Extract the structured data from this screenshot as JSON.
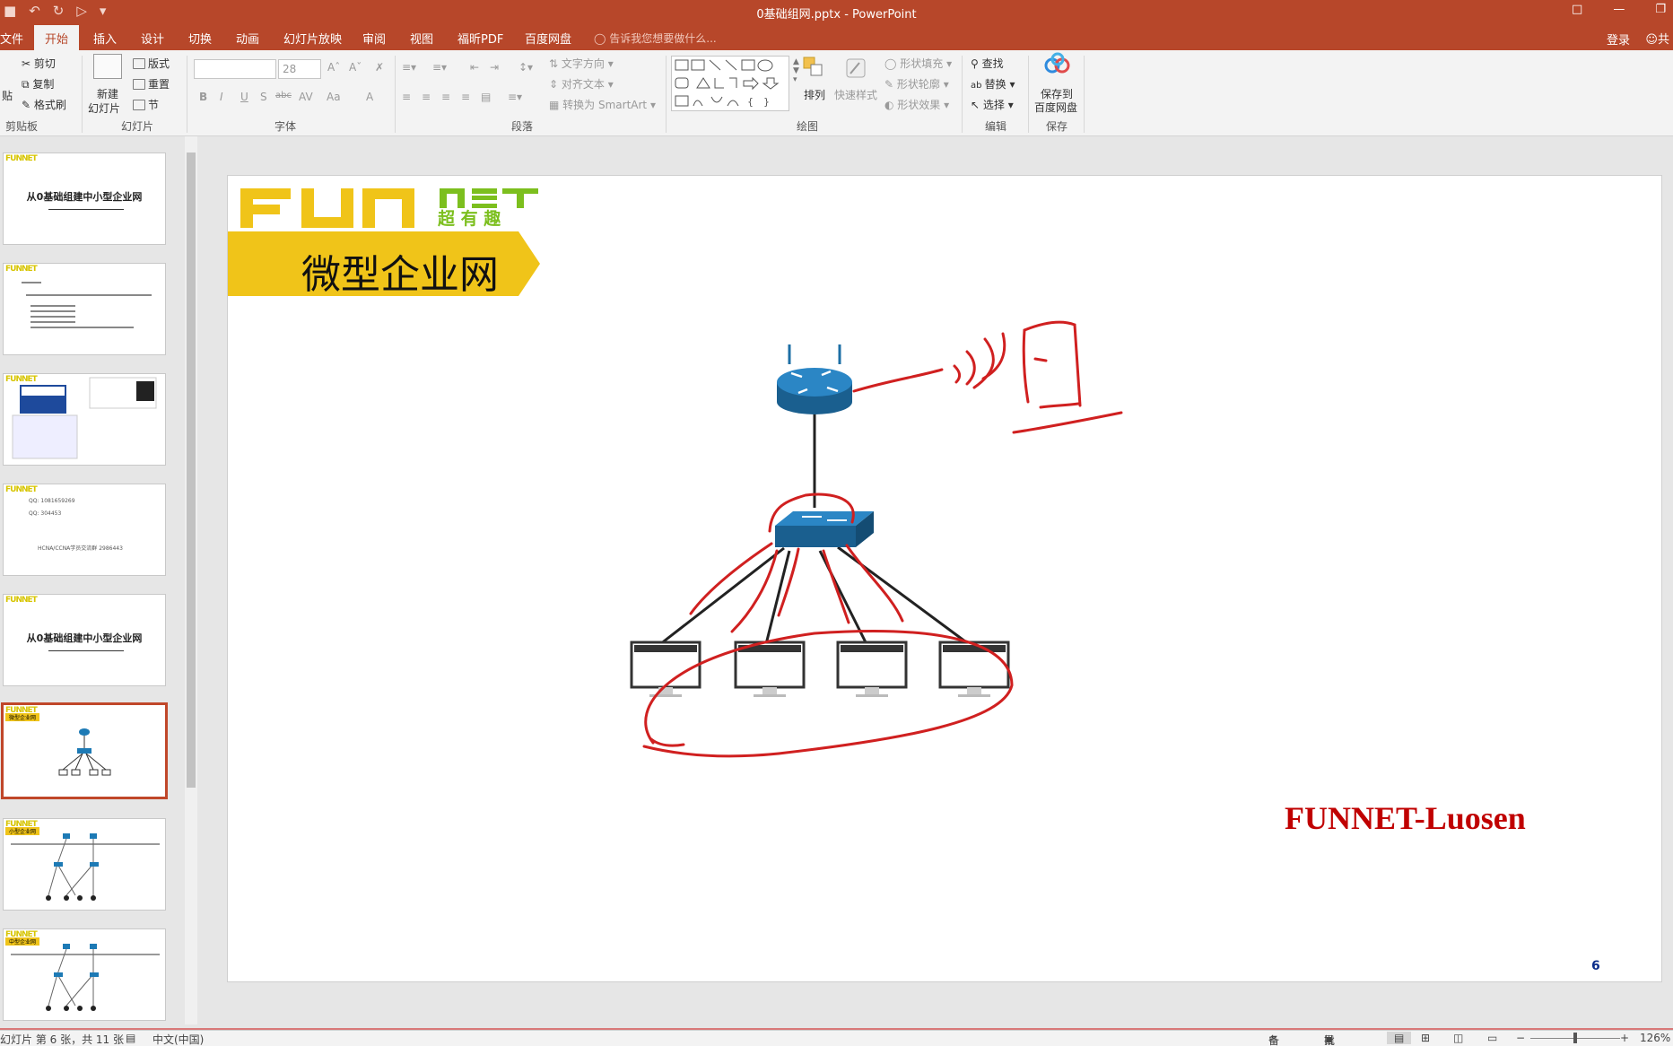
{
  "window": {
    "title": "0基础组网.pptx - PowerPoint"
  },
  "titlebar_icons": [
    "save-icon",
    "undo-icon",
    "redo-icon",
    "present-icon",
    "qat-dropdown-icon"
  ],
  "tabs": [
    "文件",
    "开始",
    "插入",
    "设计",
    "切换",
    "动画",
    "幻灯片放映",
    "审阅",
    "视图",
    "福昕PDF",
    "百度网盘"
  ],
  "active_tab": "开始",
  "tell_me": "告诉我您想要做什么...",
  "login": "登录",
  "share": "共",
  "ribbon": {
    "clipboard": {
      "paste": "贴",
      "cut": "剪切",
      "copy": "复制",
      "format_painter": "格式刷",
      "label": "剪贴板"
    },
    "slides": {
      "new_slide_line1": "新建",
      "new_slide_line2": "幻灯片",
      "layout": "版式",
      "reset": "重置",
      "section": "节",
      "label": "幻灯片"
    },
    "font": {
      "font_name": "",
      "font_size": "28",
      "label": "字体",
      "bold": "B",
      "italic": "I",
      "underline": "U",
      "shadow": "S",
      "strike": "abc",
      "spacing": "AV",
      "case": "Aa",
      "color": "A"
    },
    "paragraph": {
      "text_direction": "文字方向",
      "align_text": "对齐文本",
      "smartart": "转换为 SmartArt",
      "label": "段落"
    },
    "drawing": {
      "arrange": "排列",
      "quick_styles": "快速样式",
      "shape_fill": "形状填充",
      "shape_outline": "形状轮廓",
      "shape_effects": "形状效果",
      "label": "绘图"
    },
    "editing": {
      "find": "查找",
      "replace": "替换",
      "select": "选择",
      "label": "编辑"
    },
    "save": {
      "line1": "保存到",
      "line2": "百度网盘",
      "label": "保存"
    }
  },
  "thumbnails": [
    {
      "logo": "FUNNET",
      "title": "从0基础组建中小型企业网"
    },
    {
      "logo": "FUNNET",
      "title": ""
    },
    {
      "logo": "FUNNET",
      "title": ""
    },
    {
      "logo": "FUNNET",
      "title": "",
      "line1": "QQ: 1081659269",
      "line2": "QQ: 304453",
      "line3": "HCNA/CCNA学员交流群 2986443"
    },
    {
      "logo": "FUNNET",
      "title": "从0基础组建中小型企业网"
    },
    {
      "logo": "FUNNET",
      "title": "",
      "selected": true,
      "badge": "微型企业网"
    },
    {
      "logo": "FUNNET",
      "title": "",
      "badge": "小型企业网"
    },
    {
      "logo": "FUNNET",
      "title": "",
      "badge": "中型企业网"
    }
  ],
  "slide": {
    "logo_text": "FUN",
    "logo_net": "NET",
    "logo_sub": "超 有 趣",
    "banner": "微型企业网",
    "brand": "FUNNET-Luosen",
    "number": "6"
  },
  "status": {
    "slide_info": "幻灯片 第 6 张，共 11 张",
    "language": "中文(中国)",
    "notes": "备注",
    "comments": "批注",
    "zoom": "126%"
  },
  "colors": {
    "accent": "#b7472a",
    "brand_red": "#c00000",
    "logo_yellow": "#f0c419",
    "logo_green": "#7cbf1e"
  }
}
